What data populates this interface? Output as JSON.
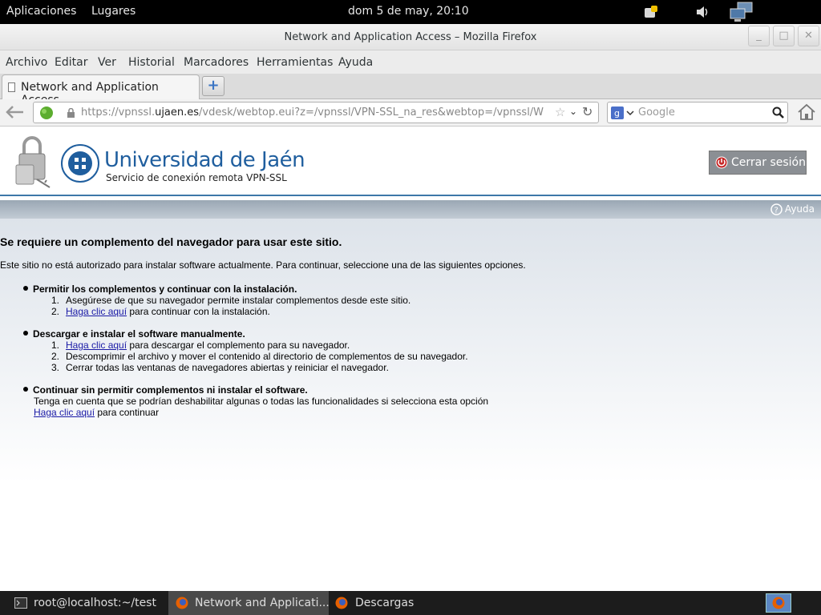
{
  "topbar": {
    "applications": "Aplicaciones",
    "places": "Lugares",
    "clock": "dom  5 de may, 20:10"
  },
  "window": {
    "title": "Network and Application Access – Mozilla Firefox"
  },
  "menu": {
    "items": [
      "Archivo",
      "Editar",
      "Ver",
      "Historial",
      "Marcadores",
      "Herramientas",
      "Ayuda"
    ]
  },
  "tabs": [
    {
      "label": "Network and Application Access"
    }
  ],
  "navbar": {
    "url_prefix": "https://vpnssl.",
    "url_domain": "ujaen.es",
    "url_path": "/vdesk/webtop.eui?z=/vpnssl/VPN-SSL_na_res&webtop=/vpnssl/W",
    "search_placeholder": "Google"
  },
  "header": {
    "university": "Universidad de Jaén",
    "subtitle": "Servicio de conexión remota VPN-SSL",
    "logout": "Cerrar sesión",
    "help": "Ayuda"
  },
  "page": {
    "heading": "Se requiere un complemento del navegador para usar este sitio.",
    "intro": "Este sitio no está autorizado para instalar software actualmente. Para continuar, seleccione una de las siguientes opciones.",
    "option1": {
      "title": "Permitir los complementos y continuar con la instalación.",
      "step1": "Asegúrese de que su navegador permite instalar complementos desde este sitio.",
      "step2_link": "Haga clic aquí",
      "step2_text": " para continuar con la instalación."
    },
    "option2": {
      "title": "Descargar e instalar el software manualmente.",
      "step1_link": "Haga clic aquí",
      "step1_text": " para descargar el complemento para su navegador.",
      "step2": "Descomprimir el archivo y mover el contenido al directorio de complementos de su navegador.",
      "step3": "Cerrar todas las ventanas de navegadores abiertas y reiniciar el navegador."
    },
    "option3": {
      "title": "Continuar sin permitir complementos ni instalar el software.",
      "note": "Tenga en cuenta que se podrían deshabilitar algunas o todas las funcionalidades si selecciona esta opción",
      "link": "Haga clic aquí",
      "link_text": " para continuar"
    },
    "numbers": [
      "1.",
      "2.",
      "3."
    ]
  },
  "taskbar": {
    "items": [
      {
        "label": "root@localhost:~/test",
        "icon": "terminal-icon"
      },
      {
        "label": "Network and Applicati...",
        "icon": "firefox-icon"
      },
      {
        "label": "Descargas",
        "icon": "firefox-icon"
      }
    ]
  },
  "colors": {
    "link": "#1a1aa6",
    "brand_blue": "#1f5e9e",
    "logout_bg": "#8b8f94"
  }
}
